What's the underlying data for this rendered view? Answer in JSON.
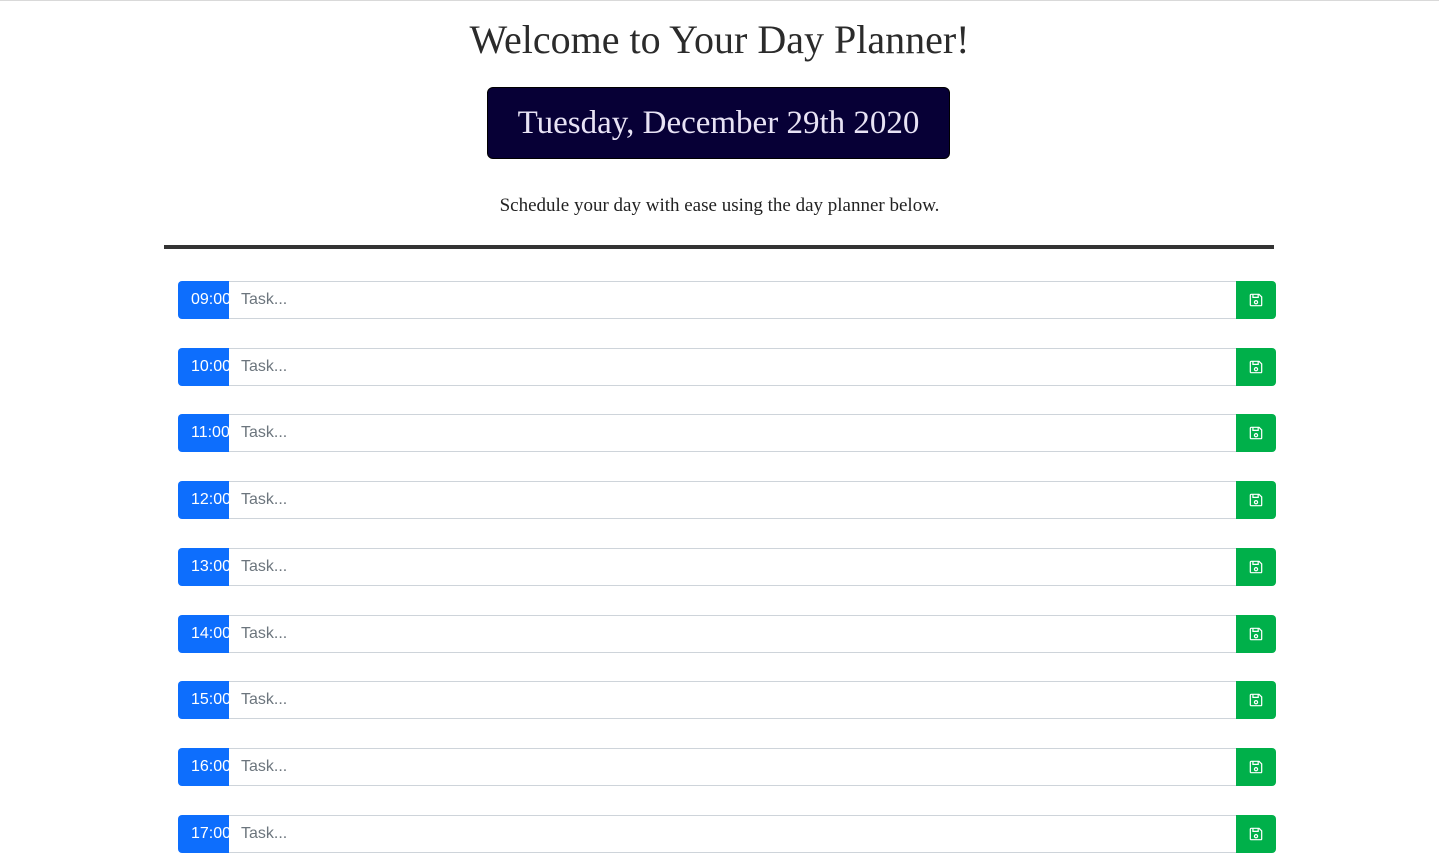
{
  "header": {
    "title": "Welcome to Your Day Planner!",
    "date": "Tuesday, December 29th 2020",
    "subtitle": "Schedule your day with ease using the day planner below."
  },
  "colors": {
    "hour_badge": "#0d6efd",
    "save_button": "#00b04a",
    "date_box": "#070036"
  },
  "task_placeholder": "Task...",
  "save_icon": "floppy-disk-icon",
  "rows": [
    {
      "hour": "09:00",
      "task": ""
    },
    {
      "hour": "10:00",
      "task": ""
    },
    {
      "hour": "11:00",
      "task": ""
    },
    {
      "hour": "12:00",
      "task": ""
    },
    {
      "hour": "13:00",
      "task": ""
    },
    {
      "hour": "14:00",
      "task": ""
    },
    {
      "hour": "15:00",
      "task": ""
    },
    {
      "hour": "16:00",
      "task": ""
    },
    {
      "hour": "17:00",
      "task": ""
    }
  ]
}
